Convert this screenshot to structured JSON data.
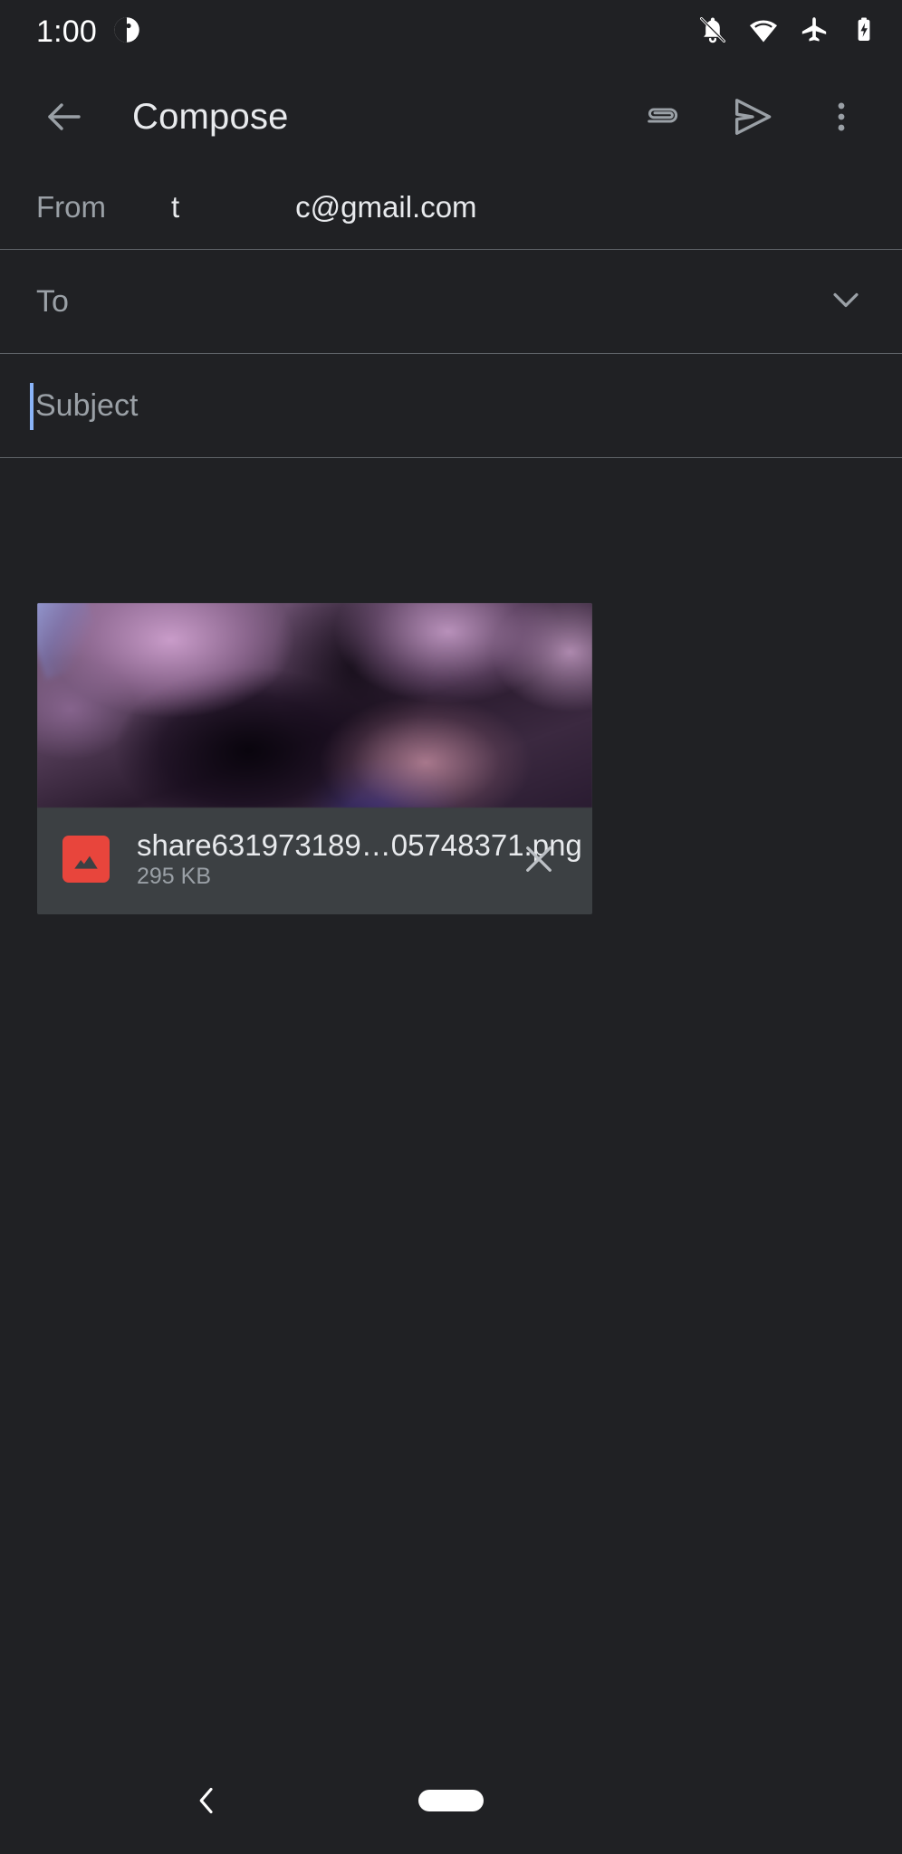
{
  "status_bar": {
    "time": "1:00",
    "icons": [
      {
        "name": "notification-badge-icon"
      },
      {
        "name": "notifications-off-icon"
      },
      {
        "name": "wifi-icon"
      },
      {
        "name": "airplane-mode-icon"
      },
      {
        "name": "battery-charging-icon"
      }
    ]
  },
  "app_bar": {
    "back_label": "back-arrow",
    "title": "Compose",
    "attach_label": "attach-file",
    "send_label": "send",
    "more_label": "more-options"
  },
  "compose": {
    "from": {
      "label": "From",
      "value_prefix": "t",
      "value_suffix": "c@gmail.com"
    },
    "to": {
      "placeholder": "To",
      "expand_label": "expand-recipients"
    },
    "subject": {
      "placeholder": "Subject",
      "value": ""
    },
    "body": {
      "placeholder": ""
    }
  },
  "attachment": {
    "filename": "share631973189…05748371.png",
    "size": "295 KB",
    "type_icon": "image-file-icon",
    "remove_label": "remove-attachment"
  },
  "nav_bar": {
    "back_label": "back",
    "home_label": "home-gesture-pill"
  },
  "colors": {
    "background": "#202124",
    "divider": "#5f6368",
    "text_primary": "#e8eaed",
    "text_secondary": "#9aa0a6",
    "caret": "#8ab4f8",
    "card": "#3c4043",
    "file_icon": "#e8453c"
  }
}
